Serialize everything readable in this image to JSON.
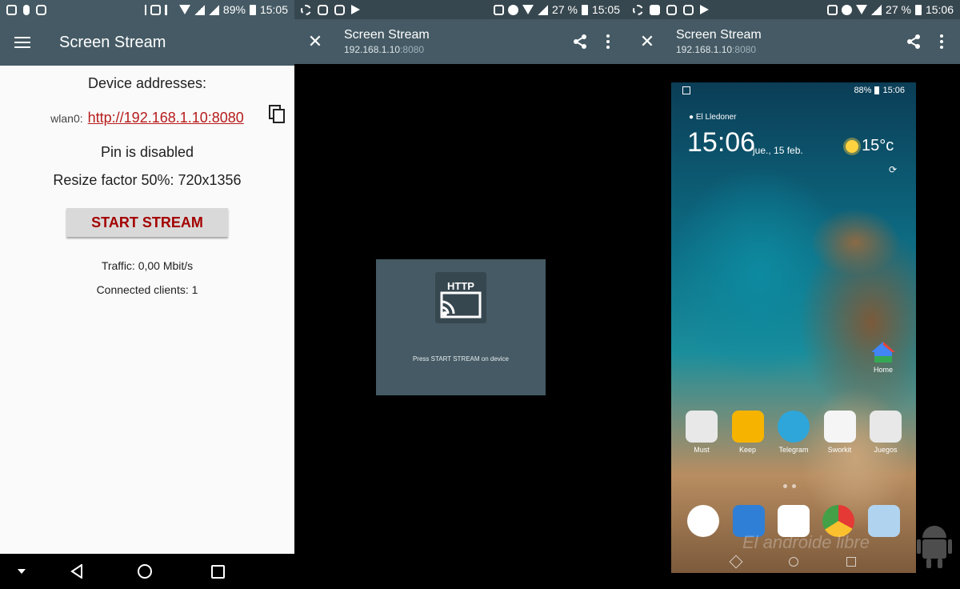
{
  "screen1": {
    "status": {
      "battery": "89%",
      "time": "15:05"
    },
    "appbar": {
      "title": "Screen Stream"
    },
    "content": {
      "heading": "Device addresses:",
      "iface_label": "wlan0:",
      "address_link": "http://192.168.1.10:8080",
      "pin_status": "Pin is disabled",
      "resize": "Resize factor 50%: 720x1356",
      "start_button": "START STREAM",
      "traffic": "Traffic: 0,00 Mbit/s",
      "clients": "Connected clients: 1"
    }
  },
  "screen2": {
    "status": {
      "battery": "27 %",
      "time": "15:05"
    },
    "appbar": {
      "title": "Screen Stream",
      "host": "192.168.1.10",
      "port": ":8080"
    },
    "stream": {
      "icon_text": "HTTP",
      "message": "Press START STREAM on device"
    }
  },
  "screen3": {
    "status": {
      "battery": "27 %",
      "time": "15:06"
    },
    "appbar": {
      "title": "Screen Stream",
      "host": "192.168.1.10",
      "port": ":8080"
    },
    "phone": {
      "status": {
        "battery": "88%",
        "time": "15:06"
      },
      "location": "El Lledoner",
      "clock": "15:06",
      "date": "jue., 15 feb.",
      "temperature": "15°c",
      "home_app": "Home",
      "apps": [
        {
          "label": "Must",
          "color": "#e8e8e8"
        },
        {
          "label": "Keep",
          "color": "#f6b400"
        },
        {
          "label": "Telegram",
          "color": "#2ea6da"
        },
        {
          "label": "Sworkit",
          "color": "#f5f5f5"
        },
        {
          "label": "Juegos",
          "color": "#e8e8e8"
        }
      ],
      "dock": [
        {
          "name": "launcher-app",
          "color": "#ffffff"
        },
        {
          "name": "inbox-app",
          "color": "#2f7fd6"
        },
        {
          "name": "app-drawer",
          "color": "#ffffff"
        },
        {
          "name": "chrome-app",
          "color": "#e53935"
        },
        {
          "name": "camera-app",
          "color": "#b0d4f0"
        }
      ],
      "watermark": "El androide libre"
    }
  }
}
